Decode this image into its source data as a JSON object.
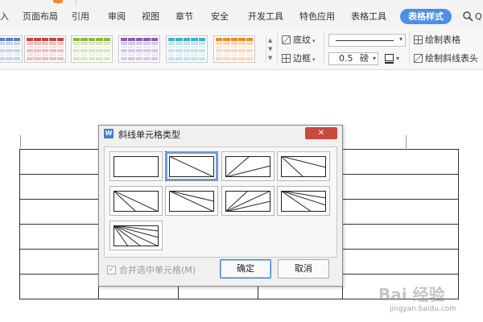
{
  "ribbon": {
    "tabs": [
      {
        "label": "入",
        "active": false
      },
      {
        "label": "页面布局",
        "active": false
      },
      {
        "label": "引用",
        "active": false
      },
      {
        "label": "审阅",
        "active": false
      },
      {
        "label": "视图",
        "active": false
      },
      {
        "label": "章节",
        "active": false
      },
      {
        "label": "安全",
        "active": false
      },
      {
        "label": "开发工具",
        "active": false
      },
      {
        "label": "特色应用",
        "active": false
      },
      {
        "label": "表格工具",
        "active": false
      },
      {
        "label": "表格样式",
        "active": true
      },
      {
        "label": "Q",
        "active": false
      }
    ],
    "style_gallery_colors": [
      "#5b7fc6",
      "#d04040",
      "#8cb840",
      "#8a5ab6",
      "#3fb0c8",
      "#f08a24"
    ],
    "shading_label": "底纹",
    "border_label": "边框",
    "line_width_value": "0.5",
    "line_width_unit": "磅",
    "draw_table_label": "绘制表格",
    "draw_diagonal_header_label": "绘制斜线表头"
  },
  "dialog": {
    "logo": "W",
    "title": "斜线单元格类型",
    "close_glyph": "✕",
    "options": [
      {
        "name": "no-diagonal",
        "selected": false
      },
      {
        "name": "single-diagonal",
        "selected": true
      },
      {
        "name": "two-line-top-right",
        "selected": false
      },
      {
        "name": "two-line-bottom-left",
        "selected": false
      },
      {
        "name": "two-line-top-left",
        "selected": false
      },
      {
        "name": "three-line-variant-a",
        "selected": false
      },
      {
        "name": "three-line-variant-b",
        "selected": false
      },
      {
        "name": "three-line-variant-c",
        "selected": false
      },
      {
        "name": "multi-line",
        "selected": false
      }
    ],
    "merge_checkbox_label": "合并选中单元格(M)",
    "merge_checked": true,
    "merge_enabled": false,
    "ok_label": "确定",
    "cancel_label": "取消"
  },
  "watermark": {
    "logo": "Bai 经验",
    "url": "jingyan.baidu.com"
  },
  "colors": {
    "accent": "#4a8fe8",
    "close_button": "#c74a3d"
  }
}
